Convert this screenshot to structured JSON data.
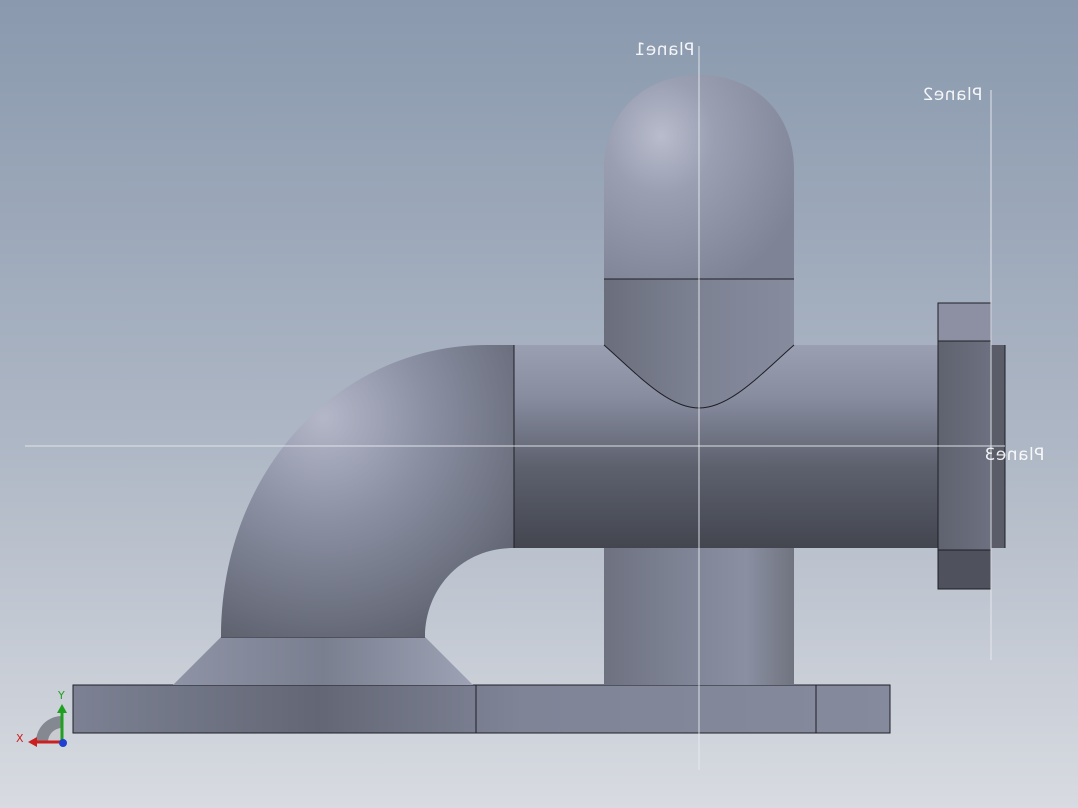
{
  "planes": {
    "plane1": "Plane1",
    "plane2": "Plane2",
    "plane3": "Plane3"
  },
  "triad": {
    "x_label": "X",
    "y_label": "Y"
  },
  "colors": {
    "background_top": "#8b9ab0",
    "background_bottom": "#d6d9df",
    "part_light": "#b2b6c6",
    "part_mid": "#858a9e",
    "part_dark": "#4c505c",
    "edge": "#1e1f26",
    "plane_line": "#e9ecf1",
    "axis_x": "#cc2020",
    "axis_y": "#20a020",
    "axis_z": "#2040d0"
  }
}
